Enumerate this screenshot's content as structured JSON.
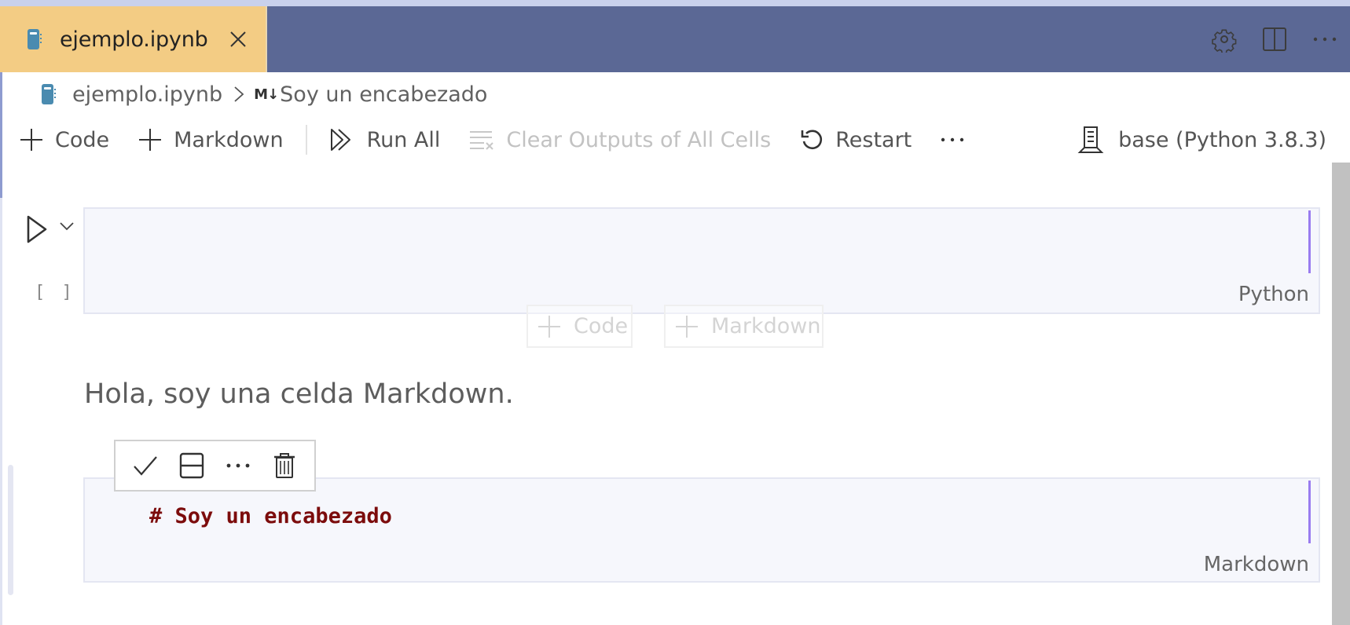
{
  "tabs": [
    {
      "label": "ejemplo.ipynb",
      "icon": "notebook-icon",
      "active": true,
      "closable": true
    }
  ],
  "window_actions": [
    {
      "name": "settings",
      "icon": "gear-icon"
    },
    {
      "name": "split-editor",
      "icon": "split-editor-icon"
    },
    {
      "name": "more-actions",
      "icon": "ellipsis-icon"
    }
  ],
  "breadcrumb": {
    "file": "ejemplo.ipynb",
    "separator_icon": "chevron-right-icon",
    "section_icon": "markdown-icon",
    "section_icon_text": "M↓",
    "section": "Soy un encabezado"
  },
  "toolbar": {
    "add_code": "Code",
    "add_markdown": "Markdown",
    "run_all": "Run All",
    "clear_outputs": "Clear Outputs of All Cells",
    "restart": "Restart",
    "more": "···",
    "kernel": "base (Python 3.8.3)"
  },
  "cells": [
    {
      "type": "code",
      "source": "",
      "execution_count": "[ ]",
      "language": "Python"
    },
    {
      "type": "markdown-rendered",
      "text": "Hola, soy una celda Markdown."
    },
    {
      "type": "markdown-editing",
      "source": "# Soy un encabezado",
      "language": "Markdown"
    }
  ],
  "insert_buttons": {
    "code": "Code",
    "markdown": "Markdown"
  },
  "cell_toolbar": [
    {
      "name": "stop-editing",
      "icon": "check-icon"
    },
    {
      "name": "split-cell",
      "icon": "split-cell-icon"
    },
    {
      "name": "more",
      "icon": "ellipsis-icon"
    },
    {
      "name": "delete",
      "icon": "trash-icon"
    }
  ],
  "colors": {
    "tab_active_bg": "#f3cc84",
    "tabbar_bg": "#5b6895",
    "cell_bg": "#f6f7fc",
    "cursor": "#9a7cf0",
    "markdown_heading": "#7c0c0c",
    "scrollbar": "#c1c1c1"
  }
}
